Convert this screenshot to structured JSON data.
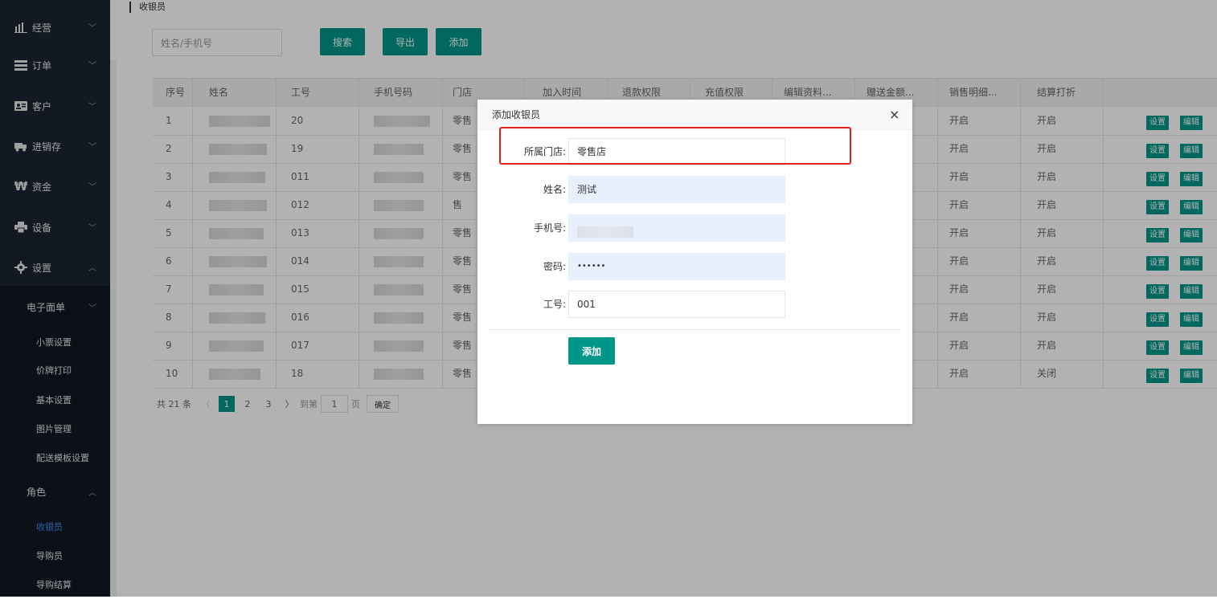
{
  "sidebar": {
    "menu": [
      {
        "label": "经营",
        "icon": "bar-chart-icon"
      },
      {
        "label": "订单",
        "icon": "list-icon"
      },
      {
        "label": "客户",
        "icon": "contact-card-icon"
      },
      {
        "label": "进销存",
        "icon": "truck-icon"
      },
      {
        "label": "资金",
        "icon": "won-icon"
      },
      {
        "label": "设备",
        "icon": "printer-icon"
      },
      {
        "label": "设置",
        "icon": "gear-icon"
      }
    ],
    "sub": {
      "group1": "电子面单",
      "items1": [
        "小票设置",
        "价牌打印",
        "基本设置",
        "图片管理",
        "配送模板设置"
      ],
      "group2": "角色",
      "items2": [
        "收银员",
        "导购员",
        "导购结算"
      ]
    }
  },
  "breadcrumb": "收银员",
  "toolbar": {
    "search_placeholder": "姓名/手机号",
    "search_btn": "搜索",
    "export_btn": "导出",
    "add_btn": "添加"
  },
  "table": {
    "headers": [
      "序号",
      "姓名",
      "工号",
      "手机号码",
      "门店",
      "加入时间",
      "退款权限",
      "充值权限",
      "编辑资料...",
      "赠送金额...",
      "销售明细...",
      "结算打折"
    ],
    "rows": [
      {
        "no": "1",
        "id": "20",
        "store": "零售",
        "sales": "开启",
        "discount": "开启"
      },
      {
        "no": "2",
        "id": "19",
        "store": "零售",
        "sales": "开启",
        "discount": "开启"
      },
      {
        "no": "3",
        "id": "011",
        "store": "零售",
        "sales": "开启",
        "discount": "开启"
      },
      {
        "no": "4",
        "id": "012",
        "store": "售",
        "sales": "开启",
        "discount": "开启"
      },
      {
        "no": "5",
        "id": "013",
        "store": "零售",
        "sales": "开启",
        "discount": "开启"
      },
      {
        "no": "6",
        "id": "014",
        "store": "零售",
        "sales": "开启",
        "discount": "开启"
      },
      {
        "no": "7",
        "id": "015",
        "store": "零售",
        "sales": "开启",
        "discount": "开启"
      },
      {
        "no": "8",
        "id": "016",
        "store": "零售",
        "sales": "开启",
        "discount": "开启"
      },
      {
        "no": "9",
        "id": "017",
        "store": "零售",
        "sales": "开启",
        "discount": "开启"
      },
      {
        "no": "10",
        "id": "18",
        "store": "零售",
        "sales": "开启",
        "discount": "关闭"
      }
    ],
    "set_btn": "设置",
    "edit_btn": "编辑"
  },
  "pager": {
    "total": "共 21 条",
    "pages": [
      "1",
      "2",
      "3"
    ],
    "goto": "到第",
    "page_input": "1",
    "page_unit": "页",
    "confirm": "确定"
  },
  "dialog": {
    "title": "添加收银员",
    "close": "×",
    "fields": [
      {
        "label": "所属门店:",
        "value": "零售店"
      },
      {
        "label": "姓名:",
        "value": "测试"
      },
      {
        "label": "手机号:",
        "value": ""
      },
      {
        "label": "密码:",
        "value": "••••••"
      },
      {
        "label": "工号:",
        "value": "001"
      }
    ],
    "submit": "添加"
  },
  "colors": {
    "accent": "#009688",
    "sidebar": "#1c2433",
    "highlight": "#e02020",
    "active_link": "#3b8ff6"
  }
}
